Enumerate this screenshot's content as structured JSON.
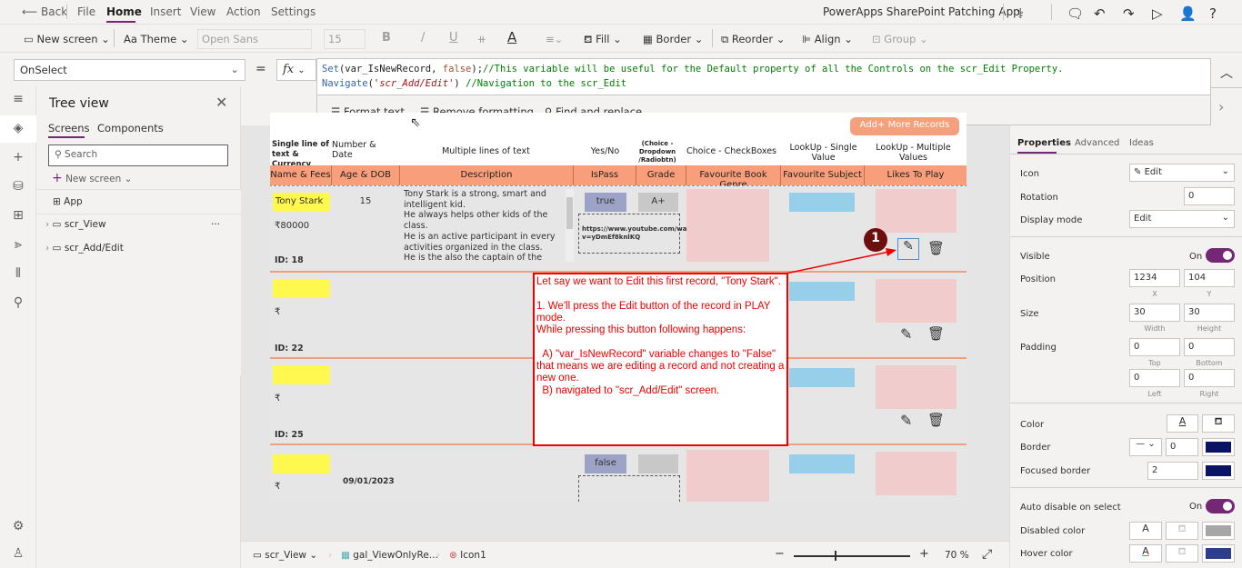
{
  "app": {
    "title": "PowerApps SharePoint Patching App"
  },
  "menu": {
    "back": "Back",
    "items": [
      "File",
      "Home",
      "Insert",
      "View",
      "Action",
      "Settings"
    ],
    "active": "Home"
  },
  "ribbon": {
    "new_screen": "New screen",
    "theme": "Theme",
    "font": "Open Sans",
    "font_size": "15",
    "bold": "B",
    "italic": "/",
    "underline": "U",
    "fill": "Fill",
    "border": "Border",
    "reorder": "Reorder",
    "align": "Align",
    "group": "Group"
  },
  "formula_bar": {
    "property": "OnSelect",
    "equals": "=",
    "fx": "fx",
    "line1": {
      "fn": "Set",
      "args_a": "(var_IsNewRecord, ",
      "kw": "false",
      "args_b": ");",
      "comment": "//This variable will be useful for the Default property of all the Controls on the scr_Edit Property."
    },
    "line2": {
      "fn": "Navigate",
      "open": "(",
      "str": "'scr_Add/Edit'",
      "close": ") ",
      "comment": "//Navigation to the scr_Edit"
    },
    "tools": {
      "format_text": "Format text",
      "remove_formatting": "Remove formatting",
      "find_replace": "Find and replace"
    }
  },
  "tree": {
    "title": "Tree view",
    "tabs": [
      "Screens",
      "Components"
    ],
    "search_placeholder": "Search",
    "new_screen": "New screen",
    "items": [
      {
        "label": "App",
        "type": "app"
      },
      {
        "label": "scr_View",
        "type": "screen",
        "more": "···"
      },
      {
        "label": "scr_Add/Edit",
        "type": "screen"
      }
    ]
  },
  "gallery": {
    "add_button": "Add+ More Records",
    "group_headers": [
      "Single line of text & Currency",
      "Number & Date",
      "Multiple lines of text",
      "Yes/No",
      "(Choice - Dropdown /Radiobtn)",
      "Choice - CheckBoxes",
      "LookUp - Single Value",
      "LookUp - Multiple Values"
    ],
    "columns": [
      "Name & Fees",
      "Age & DOB",
      "Description",
      "IsPass",
      "Grade",
      "Favourite Book Genre",
      "Favourite Subject",
      "Likes To Play"
    ],
    "rows": [
      {
        "name": "Tony Stark",
        "fee": "₹80000",
        "id": "ID: 18",
        "age": "15",
        "dob": "",
        "description": "Tony Stark is a strong, smart and intelligent kid.\nHe always helps other kids of the class.\nHe is an active participant in every activities organized in the class.\nHe is the also the captain of the Under",
        "ispass": "true",
        "grade": "A+",
        "link": "https://www.youtube.com/watch?v=yDmEf8knlKQ"
      },
      {
        "name": "",
        "fee": "₹",
        "id": "ID: 22",
        "age": "",
        "dob": "",
        "description": "",
        "ispass": "",
        "grade": "",
        "link": ""
      },
      {
        "name": "",
        "fee": "₹",
        "id": "ID: 25",
        "age": "",
        "dob": "",
        "description": "",
        "ispass": "",
        "grade": "",
        "link": ""
      },
      {
        "name": "",
        "fee": "₹",
        "id": "",
        "age": "",
        "dob": "09/01/2023",
        "description": "",
        "ispass": "false",
        "grade": "",
        "link": ""
      }
    ]
  },
  "annotation": {
    "badge": "1",
    "text": "Let say we want to Edit this first record, \"Tony Stark\".\n\n1. We'll press the Edit button of the record in PLAY mode.\nWhile pressing this button following happens:\n\n  A) \"var_IsNewRecord\" variable changes to \"False\" that means we are editing a record and not creating a new one.\n  B) navigated to \"scr_Add/Edit\" screen.",
    "color": "#ff0000"
  },
  "bottom_bar": {
    "screen": "scr_View",
    "gallery": "gal_ViewOnlyRe...",
    "control": "Icon1",
    "zoom": "70",
    "zoom_unit": "%",
    "zoom_minus": "−",
    "zoom_plus": "+"
  },
  "properties": {
    "tabs": [
      "Properties",
      "Advanced",
      "Ideas"
    ],
    "icon": {
      "label": "Icon",
      "value": "Edit"
    },
    "rotation": {
      "label": "Rotation",
      "value": "0"
    },
    "display_mode": {
      "label": "Display mode",
      "value": "Edit"
    },
    "visible": {
      "label": "Visible",
      "state": "On"
    },
    "position": {
      "label": "Position",
      "x": "1234",
      "y": "104",
      "x_label": "X",
      "y_label": "Y"
    },
    "size": {
      "label": "Size",
      "width": "30",
      "height": "30",
      "w_label": "Width",
      "h_label": "Height"
    },
    "padding": {
      "label": "Padding",
      "top": "0",
      "bottom": "0",
      "left": "0",
      "right": "0",
      "top_label": "Top",
      "bottom_label": "Bottom",
      "left_label": "Left",
      "right_label": "Right"
    },
    "color": {
      "label": "Color"
    },
    "border": {
      "label": "Border",
      "width": "0",
      "color": "#0b1464"
    },
    "focused_border": {
      "label": "Focused border",
      "width": "2",
      "color": "#0b1464"
    },
    "auto_disable": {
      "label": "Auto disable on select",
      "state": "On"
    },
    "disabled_color": {
      "label": "Disabled color",
      "color": "#a6a6a6"
    },
    "hover_color": {
      "label": "Hover color",
      "color": "#2d3e8a"
    }
  },
  "colors": {
    "accent": "#742774",
    "header": "#f89e7a",
    "name_bg": "#fff94f",
    "yesno_bg": "#9da3c7"
  }
}
